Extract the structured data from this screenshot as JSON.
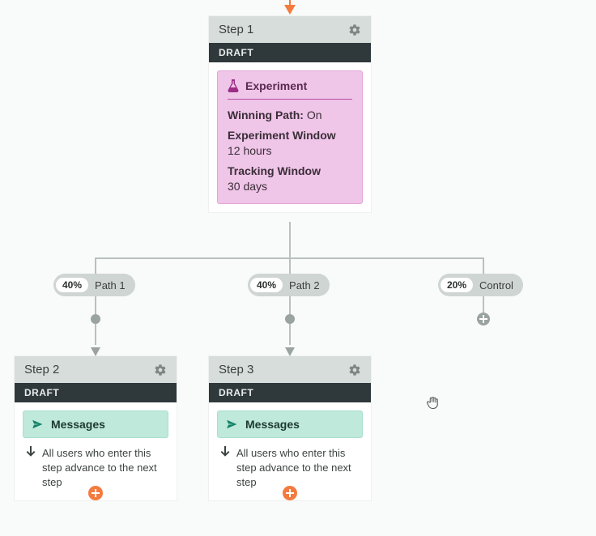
{
  "step1": {
    "title": "Step 1",
    "status": "DRAFT",
    "experiment": {
      "heading": "Experiment",
      "winning_label": "Winning Path:",
      "winning_value": "On",
      "exp_window_label": "Experiment Window",
      "exp_window_value": "12 hours",
      "track_window_label": "Tracking Window",
      "track_window_value": "30 days"
    }
  },
  "paths": {
    "p0": {
      "pct": "40%",
      "label": "Path 1"
    },
    "p1": {
      "pct": "40%",
      "label": "Path 2"
    },
    "p2": {
      "pct": "20%",
      "label": "Control"
    }
  },
  "step2": {
    "title": "Step 2",
    "status": "DRAFT",
    "messages_label": "Messages",
    "advance_text": "All users who enter this step advance to the next step"
  },
  "step3": {
    "title": "Step 3",
    "status": "DRAFT",
    "messages_label": "Messages",
    "advance_text": "All users who enter this step advance to the next step"
  }
}
